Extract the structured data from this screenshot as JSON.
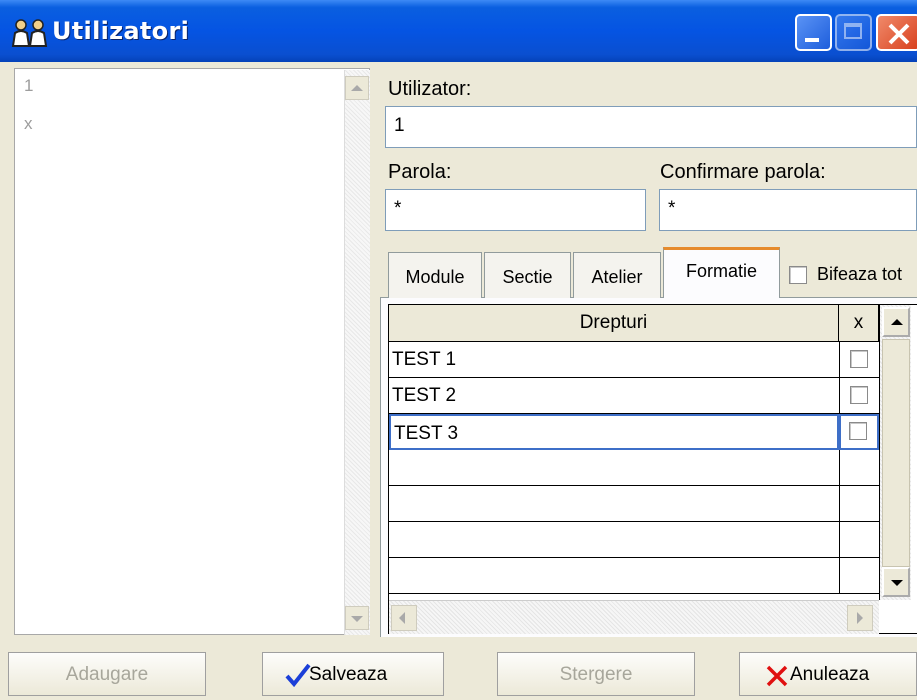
{
  "window": {
    "title": "Utilizatori"
  },
  "user_list": {
    "items": [
      "1",
      "x"
    ]
  },
  "form": {
    "user_label": "Utilizator:",
    "user_value": "1",
    "password_label": "Parola:",
    "password_value": "*",
    "confirm_label": "Confirmare parola:",
    "confirm_value": "*"
  },
  "tabs": [
    {
      "label": "Module",
      "active": false
    },
    {
      "label": "Sectie",
      "active": false
    },
    {
      "label": "Atelier",
      "active": false
    },
    {
      "label": "Formatie",
      "active": true
    }
  ],
  "select_all_label": "Bifeaza tot",
  "grid": {
    "columns": [
      "Drepturi",
      "x"
    ],
    "rows": [
      {
        "name": "TEST 1",
        "checked": false
      },
      {
        "name": "TEST 2",
        "checked": false
      },
      {
        "name": "TEST 3",
        "checked": false
      }
    ]
  },
  "buttons": {
    "add": "Adaugare",
    "save": "Salveaza",
    "delete": "Stergere",
    "cancel": "Anuleaza"
  },
  "icons": [
    "users-icon",
    "minimize-icon",
    "maximize-icon",
    "close-icon",
    "checkmark-icon",
    "cross-icon"
  ],
  "colors": {
    "titlebar": "#0554e3",
    "save_check": "#1b3fd8",
    "cancel_x": "#e01010"
  }
}
